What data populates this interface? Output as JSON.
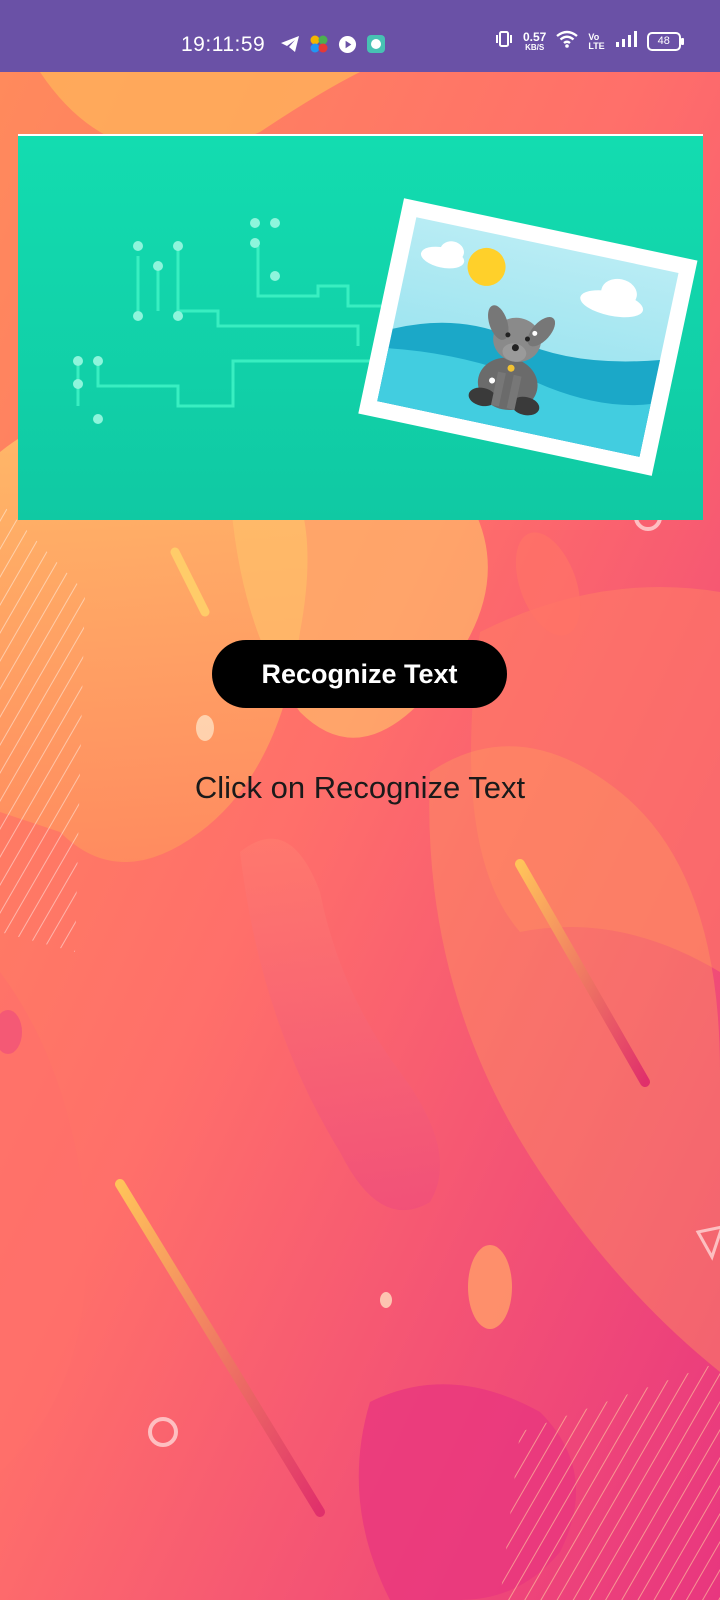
{
  "status_bar": {
    "time": "19:11:59",
    "speed_value": "0.57",
    "speed_unit": "KB/S",
    "network_label_top": "Vo",
    "network_label_bottom": "LTE",
    "battery": "48",
    "left_icons": [
      "telegram-icon",
      "pinwheel-app-icon",
      "play-icon",
      "chat-app-icon"
    ],
    "right_icons": [
      "vibrate-icon",
      "wifi-icon",
      "signal-icon",
      "battery-icon"
    ]
  },
  "banner": {
    "image": "dog-photo-illustration"
  },
  "main": {
    "button_label": "Recognize Text",
    "result_text": "Click on Recognize Text"
  },
  "colors": {
    "status_bar": "#6a51a6",
    "banner_teal": "#13d6ad",
    "button": "#000000",
    "gradient_orange": "#ffb25a",
    "gradient_pink": "#e8367f"
  }
}
